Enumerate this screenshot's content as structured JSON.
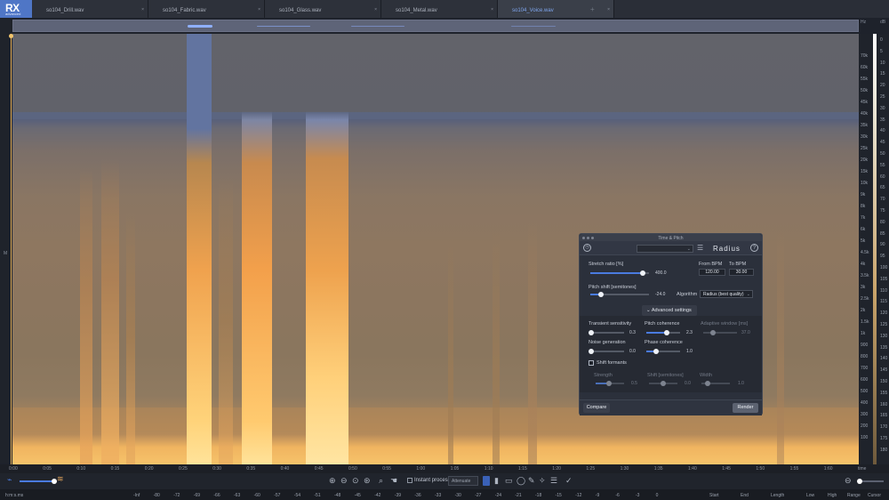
{
  "app": {
    "logo": "RX",
    "logo_sub": "advanced"
  },
  "tabs": [
    {
      "label": "so104_Drill.wav",
      "close": "×"
    },
    {
      "label": "so104_Fabric.wav",
      "close": "×"
    },
    {
      "label": "so104_Glass.wav",
      "close": "×"
    },
    {
      "label": "so104_Metal.wav",
      "close": "×"
    },
    {
      "label": "so104_Voice.wav",
      "close": "×"
    }
  ],
  "active_tab": "so104_Voice.wav",
  "left_strip_label": "M",
  "scale": {
    "hz_labels": [
      "70k",
      "60k",
      "55k",
      "50k",
      "45k",
      "40k",
      "35k",
      "30k",
      "25k",
      "20k",
      "15k",
      "10k",
      "9k",
      "8k",
      "7k",
      "6k",
      "5k",
      "4.5k",
      "4k",
      "3.5k",
      "3k",
      "2.5k",
      "2k",
      "1.5k",
      "1k",
      "900",
      "800",
      "700",
      "600",
      "500",
      "400",
      "300",
      "200",
      "100"
    ],
    "db_labels": [
      "0",
      "5",
      "10",
      "15",
      "20",
      "25",
      "30",
      "35",
      "40",
      "45",
      "50",
      "55",
      "60",
      "65",
      "70",
      "75",
      "80",
      "85",
      "90",
      "95",
      "100",
      "105",
      "110",
      "115",
      "120",
      "125",
      "130",
      "135",
      "140",
      "145",
      "150",
      "155",
      "160",
      "165",
      "170",
      "175",
      "180"
    ],
    "top_labels": [
      "Hz",
      "dB"
    ]
  },
  "time_ruler": [
    "0:00",
    "0:05",
    "0:10",
    "0:15",
    "0:20",
    "0:25",
    "0:30",
    "0:35",
    "0:40",
    "0:45",
    "0:50",
    "0:55",
    "1:00",
    "1:05",
    "1:10",
    "1:15",
    "1:20",
    "1:25",
    "1:30",
    "1:35",
    "1:40",
    "1:45",
    "1:50",
    "1:55",
    "1:60",
    "time"
  ],
  "toolbar": {
    "instant_process": "Instant process",
    "mode": "Attenuate"
  },
  "status": {
    "format": "h:m:s.ms",
    "meter_labels": [
      "-Inf",
      "-80",
      "-72",
      "-69",
      "-66",
      "-63",
      "-60",
      "-57",
      "-54",
      "-51",
      "-48",
      "-45",
      "-42",
      "-39",
      "-36",
      "-33",
      "-30",
      "-27",
      "-24",
      "-21",
      "-18",
      "-15",
      "-12",
      "-9",
      "-6",
      "-3",
      "0"
    ],
    "columns": [
      "Start",
      "End",
      "Length",
      "Low",
      "High",
      "Range",
      "Cursor"
    ]
  },
  "panel": {
    "title": "Time & Pitch",
    "brand": "Radius",
    "stretch_label": "Stretch ratio [%]",
    "stretch_value": "400.0",
    "stretch_level": 0.9,
    "from_bpm_label": "From BPM",
    "from_bpm_value": "120.00",
    "to_bpm_label": "To BPM",
    "to_bpm_value": "30.00",
    "pitch_label": "Pitch shift [semitones]",
    "pitch_value": "-24.0",
    "pitch_level": 0.18,
    "algorithm_label": "Algorithm",
    "algorithm_value": "Radius (best quality)",
    "advanced_label": "Advanced settings",
    "transient_label": "Transient sensitivity",
    "transient_value": "0.3",
    "pitch_coherence_label": "Pitch coherence",
    "pitch_coherence_value": "2.3",
    "adaptive_label": "Adaptive window [ms]",
    "adaptive_value": "37.0",
    "noise_label": "Noise generation",
    "noise_value": "0.0",
    "phase_label": "Phase coherence",
    "phase_value": "1.0",
    "shift_formants_label": "Shift formants",
    "strength_label": "Strength",
    "strength_value": "0.5",
    "shift_label": "Shift [semitones]",
    "shift_value": "0.0",
    "width_label": "Width",
    "width_value": "1.0",
    "compare_label": "Compare",
    "render_label": "Render"
  },
  "colors": {
    "accent": "#4a7be0",
    "spectrogram_hot": "#f6c36a"
  }
}
